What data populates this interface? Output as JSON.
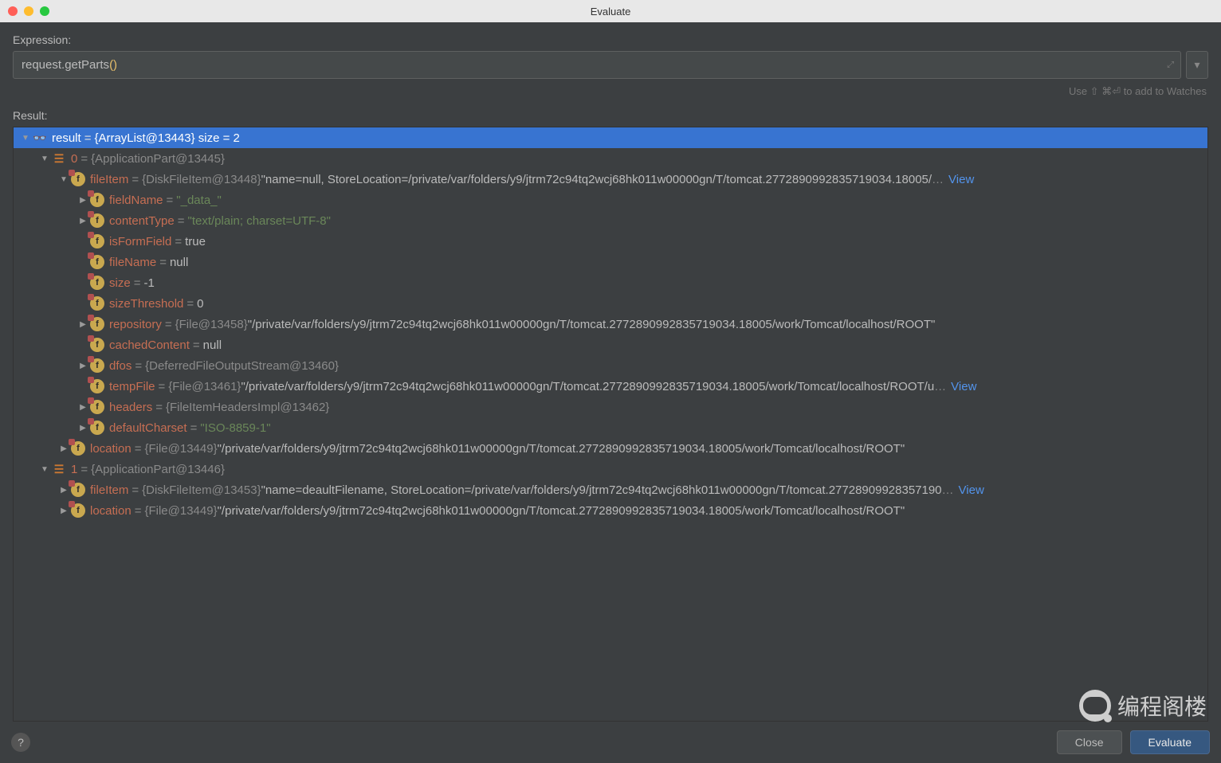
{
  "window": {
    "title": "Evaluate"
  },
  "labels": {
    "expression": "Expression:",
    "result": "Result:",
    "hint": "Use ⇧ ⌘⏎ to add to Watches"
  },
  "expression": {
    "text_head": "request.getParts",
    "text_parens": "()"
  },
  "buttons": {
    "close": "Close",
    "evaluate": "Evaluate",
    "help": "?"
  },
  "watermark": "编程阁楼",
  "tree": [
    {
      "depth": 0,
      "arrow": "down",
      "icon": "glasses",
      "name": "result",
      "valClass": "val-plain",
      "val": "{ArrayList@13443}  size = 2",
      "selected": true
    },
    {
      "depth": 1,
      "arrow": "down",
      "icon": "list",
      "name": "0",
      "valClass": "val-obj",
      "val": "{ApplicationPart@13445}"
    },
    {
      "depth": 2,
      "arrow": "down",
      "icon": "f-lock",
      "name": "fileItem",
      "valClass": "val-obj",
      "val": "{DiskFileItem@13448}",
      "tail": " \"name=null, StoreLocation=/private/var/folders/y9/jtrm72c94tq2wcj68hk011w00000gn/T/tomcat.2772890992835719034.18005/",
      "ellipsis": true,
      "view": "View"
    },
    {
      "depth": 3,
      "arrow": "right",
      "icon": "f-lock",
      "name": "fieldName",
      "valClass": "val-str",
      "val": "\"_data_\""
    },
    {
      "depth": 3,
      "arrow": "right",
      "icon": "f-lock",
      "name": "contentType",
      "valClass": "val-str",
      "val": "\"text/plain; charset=UTF-8\""
    },
    {
      "depth": 3,
      "arrow": "none",
      "icon": "f-lock",
      "name": "isFormField",
      "valClass": "val-plain",
      "val": "true"
    },
    {
      "depth": 3,
      "arrow": "none",
      "icon": "f-lock",
      "name": "fileName",
      "valClass": "val-plain",
      "val": "null"
    },
    {
      "depth": 3,
      "arrow": "none",
      "icon": "f-lock",
      "name": "size",
      "valClass": "val-plain",
      "val": "-1"
    },
    {
      "depth": 3,
      "arrow": "none",
      "icon": "f-lock",
      "name": "sizeThreshold",
      "valClass": "val-plain",
      "val": "0"
    },
    {
      "depth": 3,
      "arrow": "right",
      "icon": "f-lock",
      "name": "repository",
      "valClass": "val-obj",
      "val": "{File@13458}",
      "tail": " \"/private/var/folders/y9/jtrm72c94tq2wcj68hk011w00000gn/T/tomcat.2772890992835719034.18005/work/Tomcat/localhost/ROOT\""
    },
    {
      "depth": 3,
      "arrow": "none",
      "icon": "f-lock",
      "name": "cachedContent",
      "valClass": "val-plain",
      "val": "null"
    },
    {
      "depth": 3,
      "arrow": "right",
      "icon": "f-lock",
      "name": "dfos",
      "valClass": "val-obj",
      "val": "{DeferredFileOutputStream@13460}"
    },
    {
      "depth": 3,
      "arrow": "none",
      "icon": "f-lock",
      "name": "tempFile",
      "valClass": "val-obj",
      "val": "{File@13461}",
      "tail": " \"/private/var/folders/y9/jtrm72c94tq2wcj68hk011w00000gn/T/tomcat.2772890992835719034.18005/work/Tomcat/localhost/ROOT/u",
      "ellipsis": true,
      "view": "View"
    },
    {
      "depth": 3,
      "arrow": "right",
      "icon": "f-lock",
      "name": "headers",
      "valClass": "val-obj",
      "val": "{FileItemHeadersImpl@13462}"
    },
    {
      "depth": 3,
      "arrow": "right",
      "icon": "f-lock",
      "name": "defaultCharset",
      "valClass": "val-str",
      "val": "\"ISO-8859-1\""
    },
    {
      "depth": 2,
      "arrow": "right",
      "icon": "f-lock",
      "name": "location",
      "valClass": "val-obj",
      "val": "{File@13449}",
      "tail": " \"/private/var/folders/y9/jtrm72c94tq2wcj68hk011w00000gn/T/tomcat.2772890992835719034.18005/work/Tomcat/localhost/ROOT\""
    },
    {
      "depth": 1,
      "arrow": "down",
      "icon": "list",
      "name": "1",
      "valClass": "val-obj",
      "val": "{ApplicationPart@13446}"
    },
    {
      "depth": 2,
      "arrow": "right",
      "icon": "f-lock",
      "name": "fileItem",
      "valClass": "val-obj",
      "val": "{DiskFileItem@13453}",
      "tail": " \"name=deaultFilename, StoreLocation=/private/var/folders/y9/jtrm72c94tq2wcj68hk011w00000gn/T/tomcat.27728909928357190",
      "ellipsis": true,
      "view": "View"
    },
    {
      "depth": 2,
      "arrow": "right",
      "icon": "f-lock",
      "name": "location",
      "valClass": "val-obj",
      "val": "{File@13449}",
      "tail": " \"/private/var/folders/y9/jtrm72c94tq2wcj68hk011w00000gn/T/tomcat.2772890992835719034.18005/work/Tomcat/localhost/ROOT\""
    }
  ]
}
